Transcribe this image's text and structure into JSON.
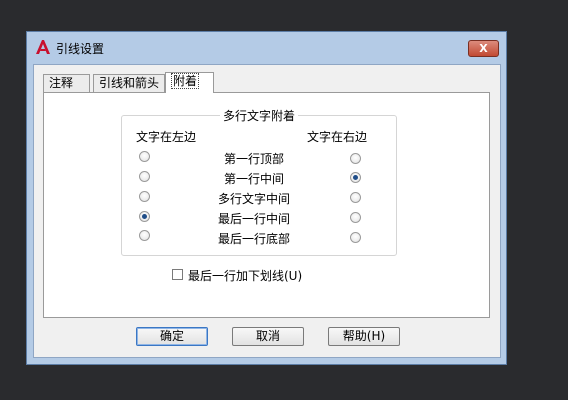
{
  "window": {
    "title": "引线设置",
    "close_label": "X"
  },
  "tabs": [
    {
      "label": "注释"
    },
    {
      "label": "引线和箭头"
    },
    {
      "label": "附着"
    }
  ],
  "group": {
    "title": "多行文字附着",
    "left_header": "文字在左边",
    "right_header": "文字在右边",
    "rows": [
      {
        "label": "第一行顶部",
        "left": false,
        "right": false
      },
      {
        "label": "第一行中间",
        "left": false,
        "right": true
      },
      {
        "label": "多行文字中间",
        "left": false,
        "right": false
      },
      {
        "label": "最后一行中间",
        "left": true,
        "right": false
      },
      {
        "label": "最后一行底部",
        "left": false,
        "right": false
      }
    ]
  },
  "underline_checkbox": {
    "label": "最后一行加下划线(U)",
    "checked": false
  },
  "buttons": {
    "ok": "确定",
    "cancel": "取消",
    "help": "帮助(H)"
  },
  "colors": {
    "accent": "#b4cbe6",
    "app_icon": "#c8102e",
    "close": "#c24a33"
  }
}
